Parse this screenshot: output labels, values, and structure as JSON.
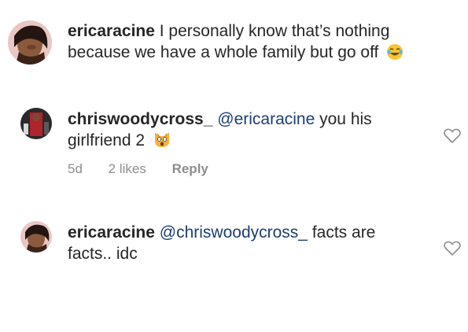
{
  "comments": [
    {
      "username": "ericaracine",
      "text": "I personally know that’s nothing because we have a whole family but go off",
      "emoji": "face-with-tears-of-joy"
    },
    {
      "username": "chriswoodycross_",
      "mention": "@ericaracine",
      "text": "you his girlfriend 2",
      "emoji": "weary-cat",
      "time": "5d",
      "likes": "2 likes",
      "reply": "Reply"
    },
    {
      "username": "ericaracine",
      "mention": "@chriswoodycross_",
      "text": "facts are facts.. idc"
    }
  ],
  "colors": {
    "text": "#262626",
    "mention": "#1c3f72",
    "meta": "#8e8e8e"
  }
}
